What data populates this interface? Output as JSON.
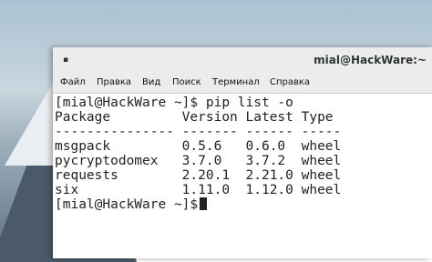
{
  "window": {
    "title": "mial@HackWare:~",
    "menu_icon": "▪"
  },
  "menu": [
    "Файл",
    "Правка",
    "Вид",
    "Поиск",
    "Терминал",
    "Справка"
  ],
  "terminal": {
    "lines": [
      "[mial@HackWare ~]$ pip list -o",
      "Package         Version Latest Type",
      "--------------- ------- ------ -----",
      "msgpack         0.5.6   0.6.0  wheel",
      "pycryptodomex   3.7.0   3.7.2  wheel",
      "requests        2.20.1  2.21.0 wheel",
      "six             1.11.0  1.12.0 wheel",
      "[mial@HackWare ~]$"
    ]
  }
}
